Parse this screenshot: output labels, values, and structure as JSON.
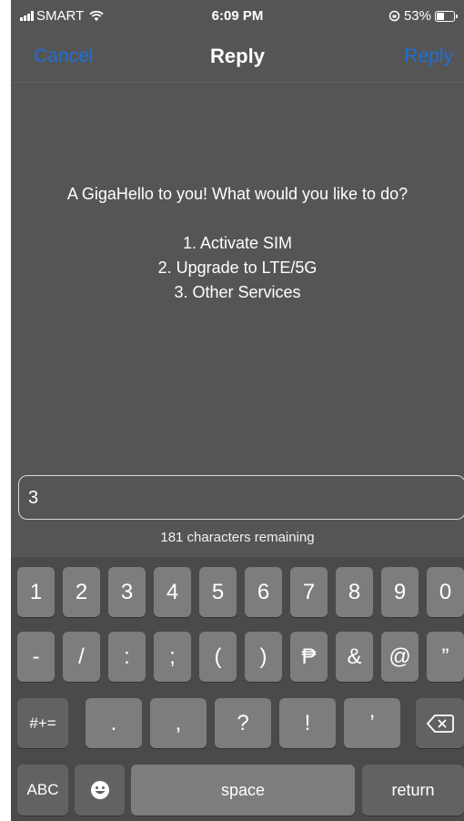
{
  "status_bar": {
    "carrier": "SMART",
    "time": "6:09 PM",
    "battery": "53%",
    "battery_level": 0.53,
    "icons": [
      "signal-icon",
      "wifi-icon",
      "orientation-lock-icon",
      "battery-icon"
    ]
  },
  "nav": {
    "cancel": "Cancel",
    "title": "Reply",
    "reply": "Reply"
  },
  "message": {
    "intro": "A GigaHello to you! What would you like to do?",
    "options": [
      "1. Activate SIM",
      "2. Upgrade to LTE/5G",
      "3. Other Services"
    ]
  },
  "input": {
    "value": "3"
  },
  "remaining": "181 characters remaining",
  "keyboard": {
    "row1": [
      "1",
      "2",
      "3",
      "4",
      "5",
      "6",
      "7",
      "8",
      "9",
      "0"
    ],
    "row2": [
      "-",
      "/",
      ":",
      ";",
      "(",
      ")",
      "₱",
      "&",
      "@",
      "”"
    ],
    "row3_shift": "#+=",
    "row3": [
      ".",
      ",",
      "?",
      "!",
      "’"
    ],
    "abc": "ABC",
    "space": "space",
    "return": "return"
  },
  "colors": {
    "background": "#555556",
    "accent": "#1f6fd6",
    "key": "#7d7d7e",
    "key_dark": "#626263"
  }
}
